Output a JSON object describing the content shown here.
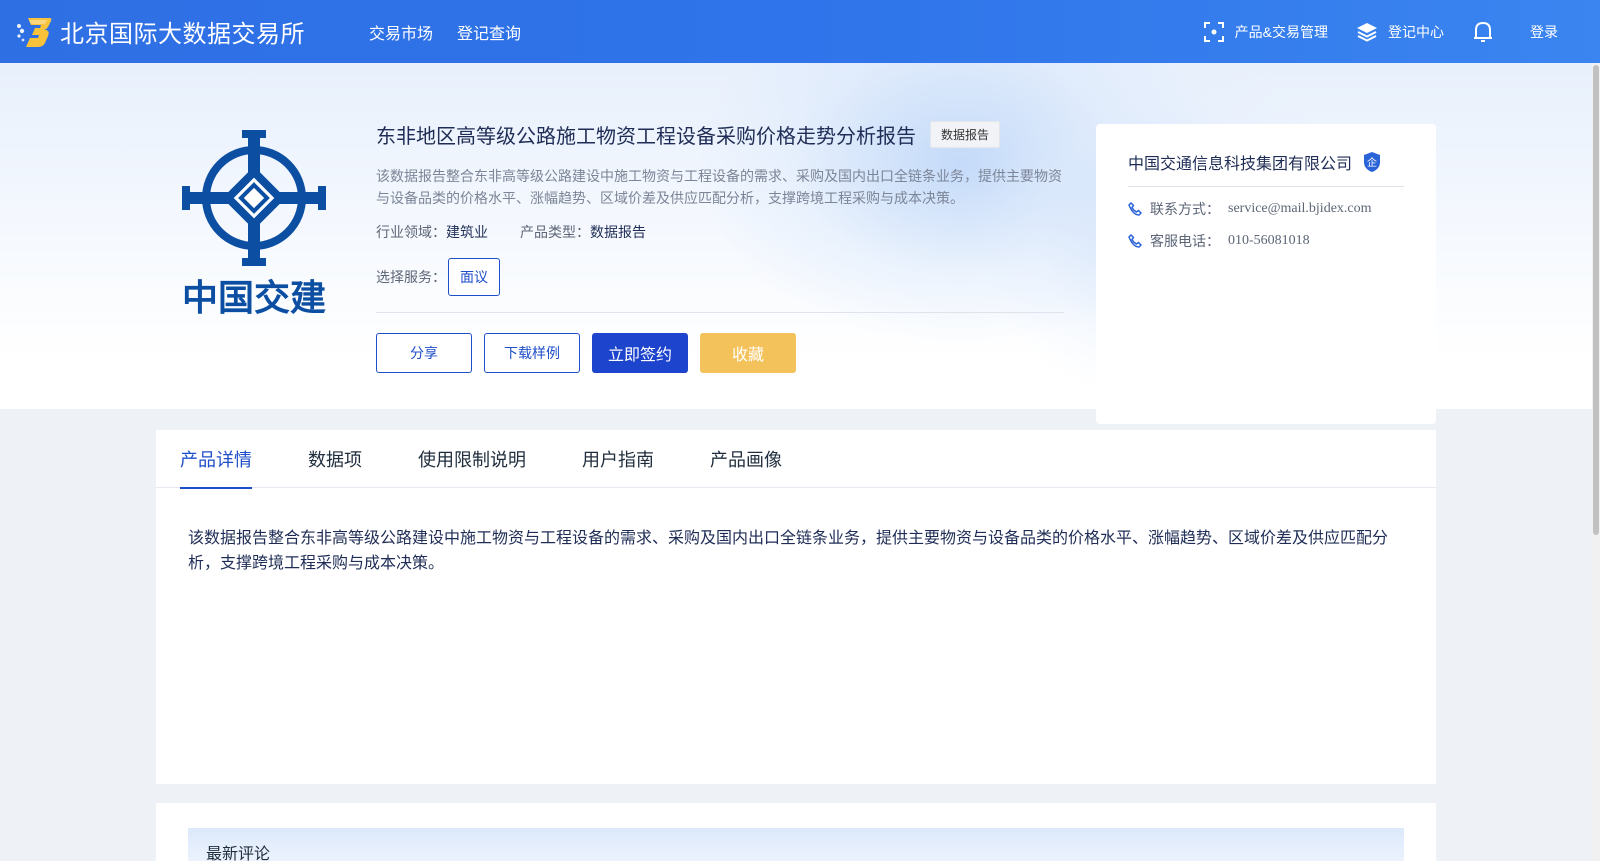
{
  "header": {
    "site_name": "北京国际大数据交易所",
    "nav": [
      "交易市场",
      "登记查询"
    ],
    "right_items": [
      {
        "label": "产品&交易管理",
        "icon": "scan-icon"
      },
      {
        "label": "登记中心",
        "icon": "layers-icon"
      }
    ],
    "bell_icon": "bell-icon",
    "login_label": "登录"
  },
  "product": {
    "logo_text": "中国交建",
    "title": "东非地区高等级公路施工物资工程设备采购价格走势分析报告",
    "tag": "数据报告",
    "description": "该数据报告整合东非高等级公路建设中施工物资与工程设备的需求、采购及国内出口全链条业务，提供主要物资与设备品类的价格水平、涨幅趋势、区域价差及供应匹配分析，支撑跨境工程采购与成本决策。",
    "industry_label": "行业领域：",
    "industry_value": "建筑业",
    "type_label": "产品类型：",
    "type_value": "数据报告",
    "service_label": "选择服务：",
    "service_option": "面议",
    "buttons": {
      "share": "分享",
      "download": "下载样例",
      "sign": "立即签约",
      "favorite": "收藏"
    }
  },
  "company": {
    "name": "中国交通信息科技集团有限公司",
    "badge": "企",
    "contact_label": "联系方式：",
    "contact_value": "service@mail.bjidex.com",
    "phone_label": "客服电话：",
    "phone_value": "010-56081018"
  },
  "tabs": [
    "产品详情",
    "数据项",
    "使用限制说明",
    "用户指南",
    "产品画像"
  ],
  "active_tab": 0,
  "detail_text": "该数据报告整合东非高等级公路建设中施工物资与工程设备的需求、采购及国内出口全链条业务，提供主要物资与设备品类的价格水平、涨幅趋势、区域价差及供应匹配分析，支撑跨境工程采购与成本决策。",
  "comments": {
    "title": "最新评论"
  },
  "colors": {
    "brand_blue": "#1e4fc9",
    "header_blue": "#2f74ea",
    "favorite_yellow": "#f4c25a",
    "logo_blue": "#0b4ea2"
  }
}
